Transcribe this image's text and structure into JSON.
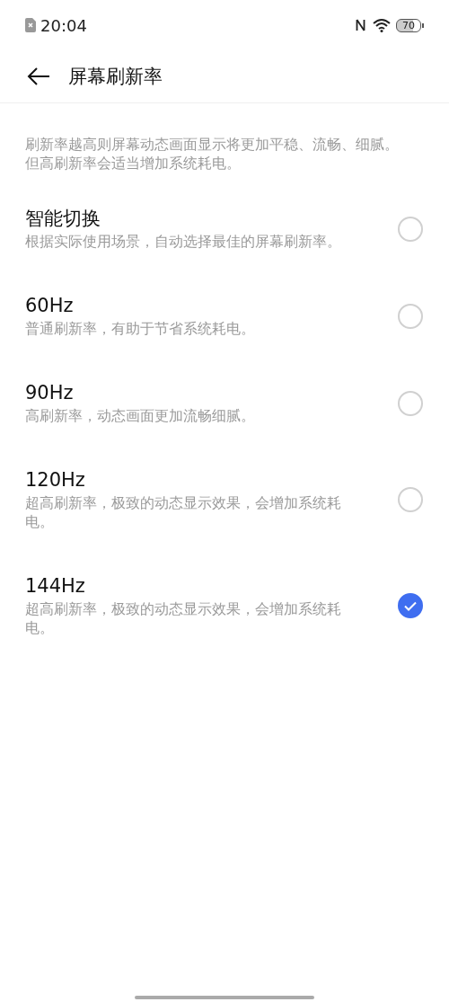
{
  "status_bar": {
    "time": "20:04",
    "battery": "70"
  },
  "header": {
    "title": "屏幕刷新率"
  },
  "description": "刷新率越高则屏幕动态画面显示将更加平稳、流畅、细腻。但高刷新率会适当增加系统耗电。",
  "options": [
    {
      "title": "智能切换",
      "subtitle": "根据实际使用场景，自动选择最佳的屏幕刷新率。",
      "selected": false
    },
    {
      "title": "60Hz",
      "subtitle": "普通刷新率，有助于节省系统耗电。",
      "selected": false
    },
    {
      "title": "90Hz",
      "subtitle": "高刷新率，动态画面更加流畅细腻。",
      "selected": false
    },
    {
      "title": "120Hz",
      "subtitle": "超高刷新率，极致的动态显示效果，会增加系统耗电。",
      "selected": false
    },
    {
      "title": "144Hz",
      "subtitle": "超高刷新率，极致的动态显示效果，会增加系统耗电。",
      "selected": true
    }
  ]
}
